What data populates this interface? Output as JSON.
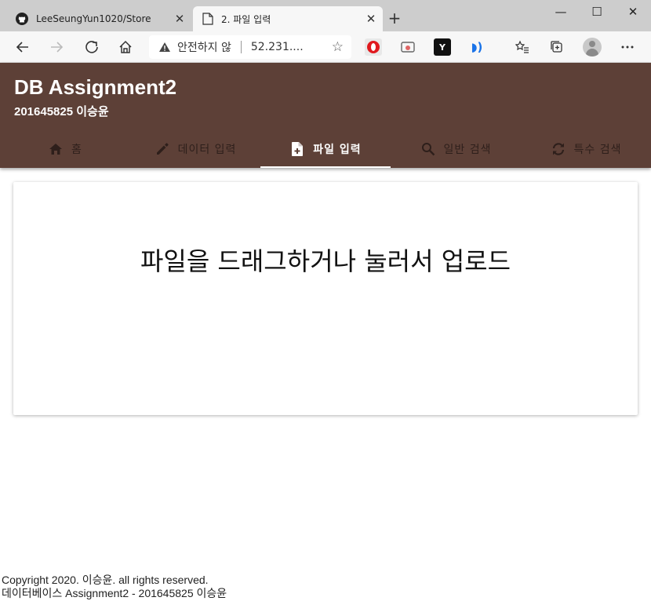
{
  "browser": {
    "tabs": [
      {
        "title": "LeeSeungYun1020/Store",
        "icon": "github-icon",
        "active": false
      },
      {
        "title": "2. 파일 입력",
        "icon": "document-icon",
        "active": true
      }
    ],
    "address": {
      "security_label": "안전하지 않",
      "url": "52.231...."
    }
  },
  "app": {
    "title": "DB Assignment2",
    "subtitle": "201645825 이승윤",
    "accent_color": "#5d4037",
    "nav": [
      {
        "label": "홈",
        "icon": "home-icon",
        "selected": false
      },
      {
        "label": "데이터 입력",
        "icon": "pencil-icon",
        "selected": false
      },
      {
        "label": "파일 입력",
        "icon": "file-plus-icon",
        "selected": true
      },
      {
        "label": "일반 검색",
        "icon": "search-icon",
        "selected": false
      },
      {
        "label": "특수 검색",
        "icon": "refresh-icon",
        "selected": false
      }
    ]
  },
  "dropzone": {
    "text": "파일을 드래그하거나 눌러서 업로드"
  },
  "footer": {
    "copyright": "Copyright 2020. 이승윤. all rights reserved.",
    "line2": "데이터베이스 Assignment2 - 201645825 이승윤"
  }
}
